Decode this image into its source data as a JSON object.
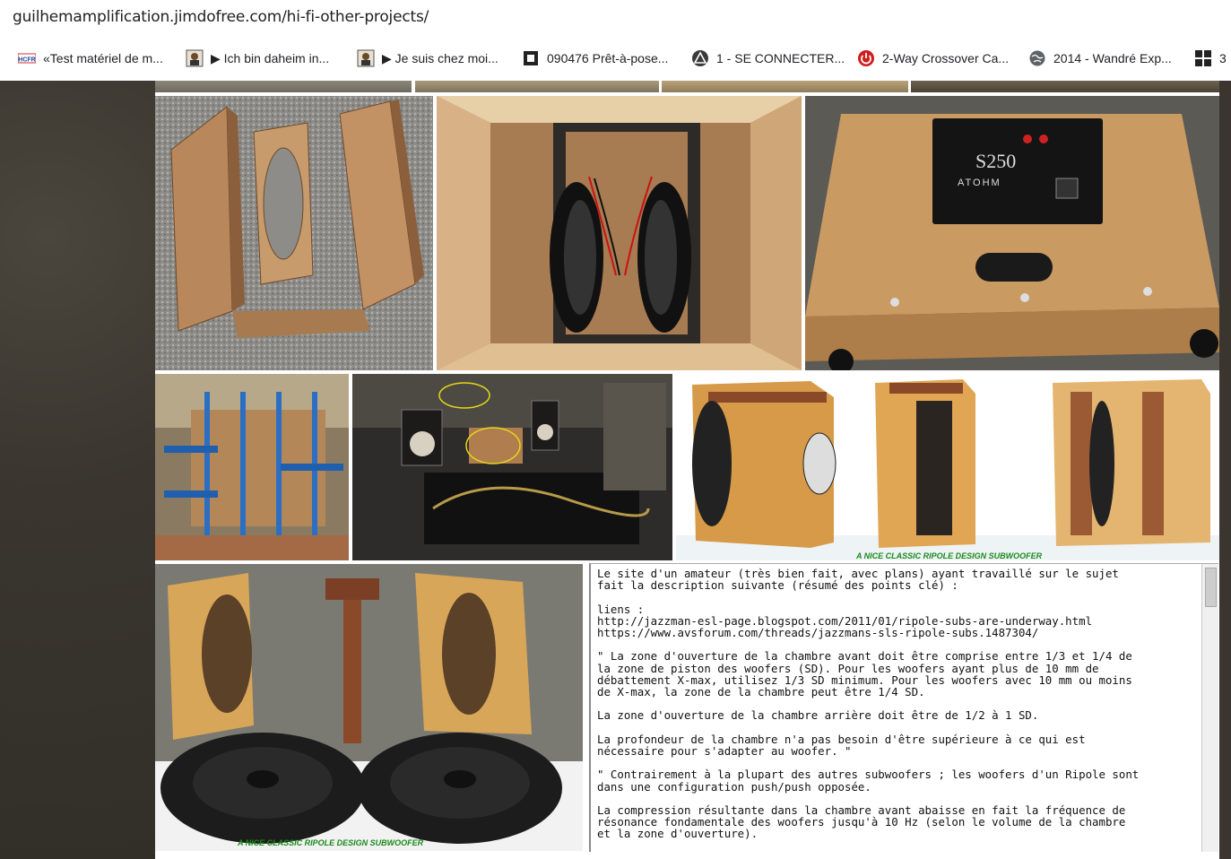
{
  "browser": {
    "url": "guilhemamplification.jimdofree.com/hi-fi-other-projects/",
    "bookmarks": [
      {
        "label": "«Test matériel de m...",
        "icon": "hcfr-icon"
      },
      {
        "label": "▶ Ich bin daheim in...",
        "icon": "avatar-icon"
      },
      {
        "label": "▶ Je suis chez moi...",
        "icon": "avatar-icon"
      },
      {
        "label": "090476 Prêt-à-pose...",
        "icon": "frame-icon"
      },
      {
        "label": "1 - SE CONNECTER...",
        "icon": "triangle-logo-icon"
      },
      {
        "label": "2-Way Crossover Ca...",
        "icon": "power-icon"
      },
      {
        "label": "2014 - Wandré Exp...",
        "icon": "globe-icon"
      },
      {
        "label": "3",
        "icon": "grid-icon"
      }
    ]
  },
  "gallery": {
    "captions": {
      "row2": "A NICE CLASSIC RIPOLE DESIGN SUBWOOFER",
      "row3": "A NICE CLASSIC RIPOLE DESIGN SUBWOOFER"
    },
    "amp_plate": {
      "model": "S250",
      "brand": "ATOHM"
    }
  },
  "article": {
    "text": "Le site d'un amateur (très bien fait, avec plans) ayant travaillé sur le sujet\nfait la description suivante (résumé des points clé) :\n\nliens :\nhttp://jazzman-esl-page.blogspot.com/2011/01/ripole-subs-are-underway.html\nhttps://www.avsforum.com/threads/jazzmans-sls-ripole-subs.1487304/\n\n\" La zone d'ouverture de la chambre avant doit être comprise entre 1/3 et 1/4 de\nla zone de piston des woofers (SD). Pour les woofers ayant plus de 10 mm de\ndébattement X-max, utilisez 1/3 SD minimum. Pour les woofers avec 10 mm ou moins\nde X-max, la zone de la chambre peut être 1/4 SD.\n\nLa zone d'ouverture de la chambre arrière doit être de 1/2 à 1 SD.\n\nLa profondeur de la chambre n'a pas besoin d'être supérieure à ce qui est\nnécessaire pour s'adapter au woofer. \"\n\n\" Contrairement à la plupart des autres subwoofers ; les woofers d'un Ripole sont\ndans une configuration push/push opposée.\n\nLa compression résultante dans la chambre avant abaisse en fait la fréquence de\nrésonance fondamentale des woofers jusqu'à 10 Hz (selon le volume de la chambre\net la zone d'ouverture)."
  }
}
